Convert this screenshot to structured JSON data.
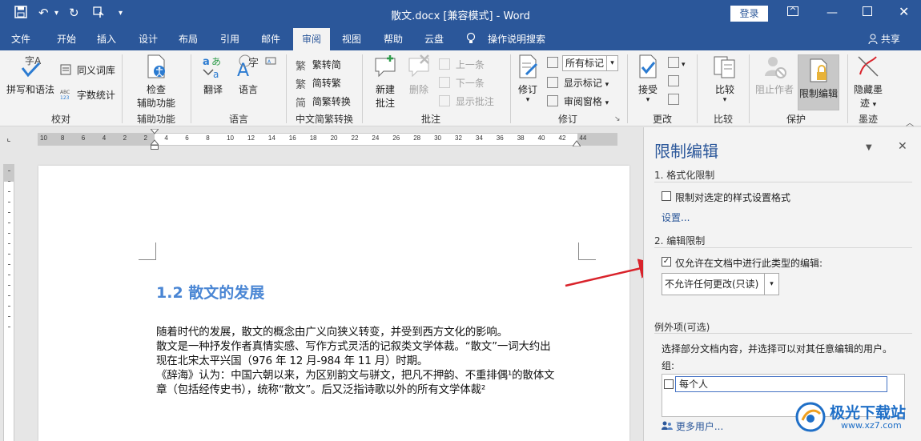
{
  "titlebar": {
    "title": "散文.docx [兼容模式] - Word",
    "login": "登录"
  },
  "tabs": [
    {
      "label": "文件"
    },
    {
      "label": "开始"
    },
    {
      "label": "插入"
    },
    {
      "label": "设计"
    },
    {
      "label": "布局"
    },
    {
      "label": "引用"
    },
    {
      "label": "邮件"
    },
    {
      "label": "审阅"
    },
    {
      "label": "视图"
    },
    {
      "label": "帮助"
    },
    {
      "label": "云盘"
    },
    {
      "label": "操作说明搜索"
    }
  ],
  "share": "共享",
  "ribbon": {
    "proofing": {
      "spell": "拼写和语法",
      "thesaurus": "同义词库",
      "wordcount": "字数统计",
      "label": "校对"
    },
    "accessibility": {
      "check": "检查",
      "check2": "辅助功能",
      "label": "辅助功能"
    },
    "language": {
      "translate": "翻译",
      "language": "语言",
      "label": "语言"
    },
    "chinese": {
      "t2s": "繁转简",
      "s2t": "简转繁",
      "convert": "简繁转换",
      "label": "中文简繁转换"
    },
    "comments": {
      "new1": "新建",
      "new2": "批注",
      "delete": "删除",
      "prev": "上一条",
      "next": "下一条",
      "show": "显示批注",
      "label": "批注"
    },
    "tracking": {
      "track": "修订",
      "markup_select": "所有标记",
      "show_markup": "显示标记",
      "pane": "审阅窗格",
      "label": "修订"
    },
    "changes": {
      "accept": "接受",
      "label": "更改"
    },
    "compare": {
      "compare": "比较",
      "label": "比较"
    },
    "protect": {
      "block": "阻止作者",
      "restrict": "限制编辑",
      "label": "保护"
    },
    "ink": {
      "hide1": "隐藏墨",
      "hide2": "迹",
      "label": "墨迹"
    }
  },
  "ruler_numbers": [
    "10",
    "8",
    "6",
    "4",
    "2",
    "2",
    "4",
    "6",
    "8",
    "10",
    "12",
    "14",
    "16",
    "18",
    "20",
    "22",
    "24",
    "26",
    "28",
    "30",
    "32",
    "34",
    "36",
    "38",
    "40",
    "42",
    "44"
  ],
  "document": {
    "heading": "1.2 散文的发展",
    "lines": [
      "随着时代的发展，散文的概念由广义向狭义转变，并受到西方文化的影响。",
      "散文是一种抒发作者真情实感、写作方式灵活的记叙类文学体裁。“散文”一词大约出",
      "现在北宋太平兴国（976 年 12 月-984 年 11 月）时期。",
      "《辞海》认为：中国六朝以来，为区别韵文与骈文，把凡不押韵、不重排偶¹的散体文",
      "章（包括经传史书），统称“散文”。后又泛指诗歌以外的所有文学体裁²"
    ]
  },
  "pane": {
    "title": "限制编辑",
    "section1": "1. 格式化限制",
    "format_check_label": "限制对选定的样式设置格式",
    "settings_link": "设置...",
    "section2": "2. 编辑限制",
    "edit_check_label": "仅允许在文档中进行此类型的编辑:",
    "edit_check_mark": "✓",
    "edit_select": "不允许任何更改(只读)",
    "exceptions_title": "例外项(可选)",
    "exceptions_desc": "选择部分文档内容，并选择可以对其任意编辑的用户。",
    "groups_label": "组:",
    "group_everyone": "每个人",
    "more_users": "更多用户..."
  },
  "watermark": {
    "name": "极光下载站",
    "url": "www.xz7.com"
  },
  "colors": {
    "brand": "#2b579a",
    "heading": "#4a86d4",
    "arrow": "#d9232b"
  }
}
